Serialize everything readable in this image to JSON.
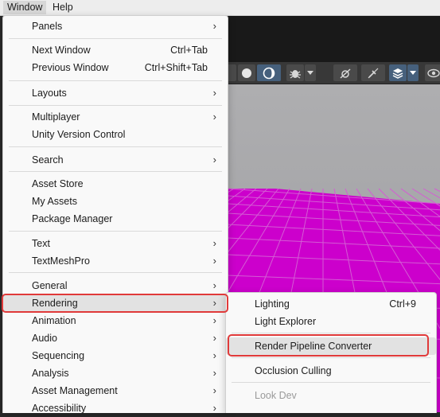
{
  "menubar": {
    "window": "Window",
    "help": "Help"
  },
  "toolbar": {
    "colors": {
      "dark": "#383838",
      "button": "#4a4a4a",
      "active": "#46607c"
    }
  },
  "scene": {
    "floor_color": "#cc00cc",
    "grid_color": "#d45cd4",
    "sky_color": "#aeaeb0"
  },
  "window_menu": {
    "items": [
      {
        "label": "Panels",
        "submenu": true
      },
      {
        "label": "Next Window",
        "shortcut": "Ctrl+Tab"
      },
      {
        "label": "Previous Window",
        "shortcut": "Ctrl+Shift+Tab"
      },
      {
        "label": "Layouts",
        "submenu": true
      },
      {
        "label": "Multiplayer",
        "submenu": true
      },
      {
        "label": "Unity Version Control"
      },
      {
        "label": "Search",
        "submenu": true
      },
      {
        "label": "Asset Store"
      },
      {
        "label": "My Assets"
      },
      {
        "label": "Package Manager"
      },
      {
        "label": "Text",
        "submenu": true
      },
      {
        "label": "TextMeshPro",
        "submenu": true
      },
      {
        "label": "General",
        "submenu": true
      },
      {
        "label": "Rendering",
        "submenu": true,
        "highlighted": true
      },
      {
        "label": "Animation",
        "submenu": true
      },
      {
        "label": "Audio",
        "submenu": true
      },
      {
        "label": "Sequencing",
        "submenu": true
      },
      {
        "label": "Analysis",
        "submenu": true
      },
      {
        "label": "Asset Management",
        "submenu": true
      },
      {
        "label": "Accessibility",
        "submenu": true
      }
    ]
  },
  "rendering_submenu": {
    "items": [
      {
        "label": "Lighting",
        "shortcut": "Ctrl+9"
      },
      {
        "label": "Light Explorer"
      },
      {
        "label": "Render Pipeline Converter",
        "highlighted": true
      },
      {
        "label": "Occlusion Culling"
      },
      {
        "label": "Look Dev",
        "disabled": true
      }
    ]
  },
  "annotation_color": "#e03a3a",
  "arrow_glyph": "›"
}
